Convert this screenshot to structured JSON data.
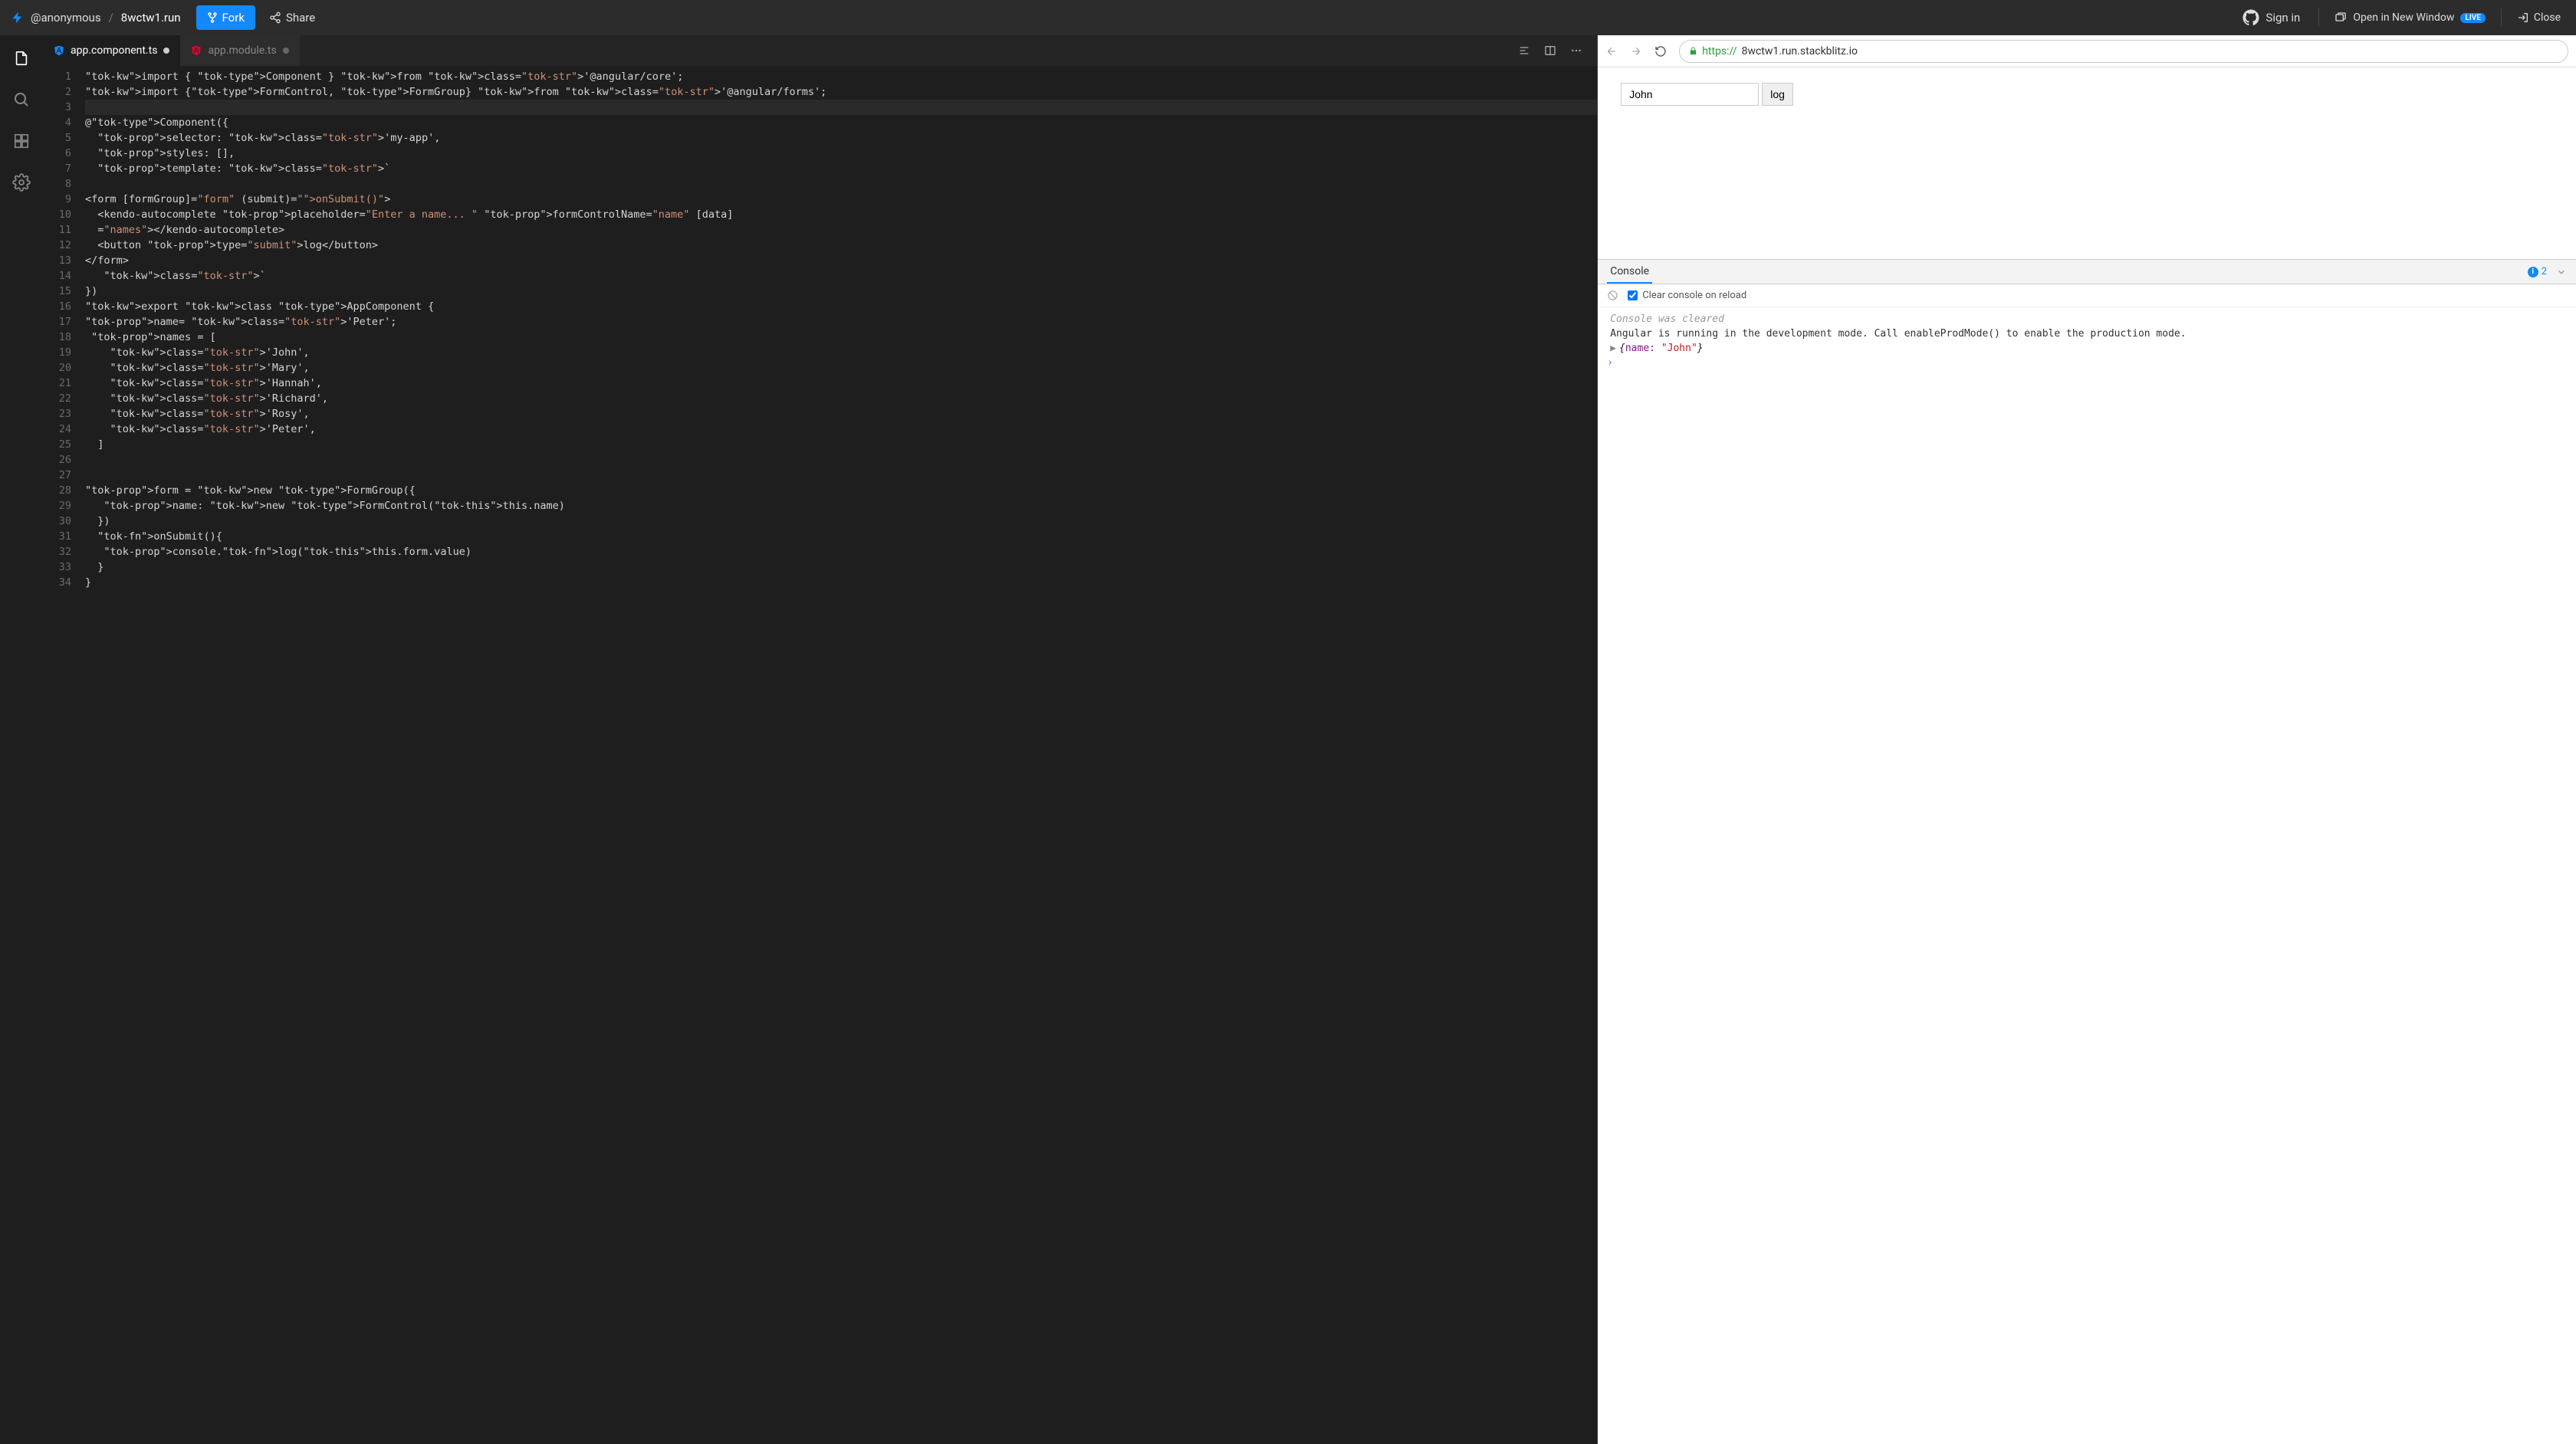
{
  "top": {
    "owner": "@anonymous",
    "project": "8wctw1.run",
    "fork": "Fork",
    "share": "Share",
    "signin": "Sign in",
    "openwin": "Open in New Window",
    "live": "LIVE",
    "close": "Close"
  },
  "tabs": [
    {
      "label": "app.component.ts",
      "active": true,
      "dirty": true
    },
    {
      "label": "app.module.ts",
      "active": false,
      "dirty": true
    }
  ],
  "code": {
    "lines": 34,
    "source": [
      "import { Component } from '@angular/core';",
      "import {FormControl, FormGroup} from '@angular/forms';",
      "",
      "@Component({",
      "  selector: 'my-app',",
      "  styles: [],",
      "  template: `",
      "",
      "<form [formGroup]=\"form\" (submit)=\"onSubmit()\">",
      "  <kendo-autocomplete placeholder=\"Enter a name... \" formControlName=\"name\" [data]",
      "  =\"names\"></kendo-autocomplete>",
      "  <button type=\"submit\">log</button>",
      "</form>",
      "   `",
      "})",
      "export class AppComponent {",
      "name= 'Peter';",
      " names = [",
      "    'John',",
      "    'Mary',",
      "    'Hannah',",
      "    'Richard',",
      "    'Rosy',",
      "    'Peter',",
      "  ]",
      "",
      "",
      "form = new FormGroup({",
      "   name: new FormControl(this.name)",
      "  })",
      "  onSubmit(){",
      "   console.log(this.form.value)",
      "  }",
      "}"
    ]
  },
  "preview": {
    "url_proto": "https://",
    "url_rest": "8wctw1.run.stackblitz.io",
    "input_value": "John",
    "button_label": "log"
  },
  "console": {
    "tab": "Console",
    "info_count": "2",
    "clear_label": "Clear console on reload",
    "cleared_msg": "Console was cleared",
    "angular_msg": "Angular is running in the development mode. Call enableProdMode() to enable the production mode.",
    "obj_key": "name:",
    "obj_val": "\"John\""
  }
}
